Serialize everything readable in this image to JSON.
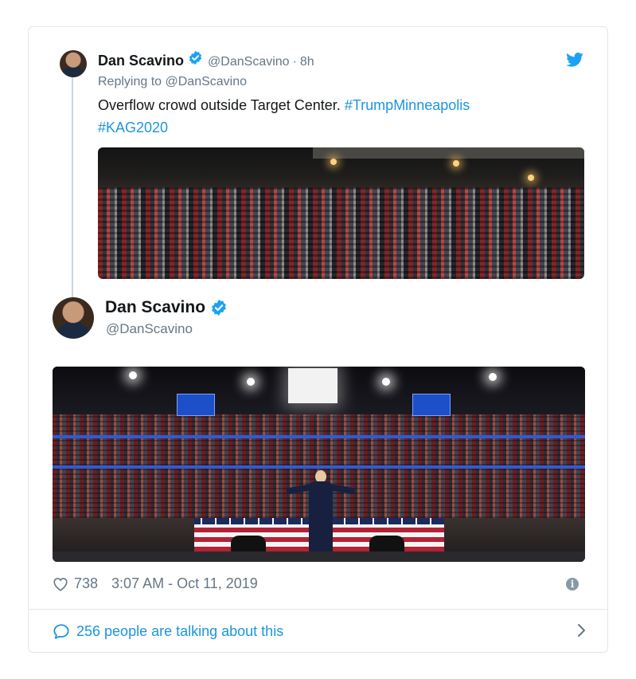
{
  "reply_tweet": {
    "name": "Dan Scavino",
    "handle": "@DanScavino",
    "dot": "·",
    "time": "8h",
    "replying_to_label": "Replying to",
    "replying_to_handle": "@DanScavino",
    "text": "Overflow crowd outside Target Center.",
    "hashtags": [
      "#TrumpMinneapolis",
      "#KAG2020"
    ],
    "icons": {
      "verified": "verified-badge-icon",
      "brand": "twitter-bird-icon"
    }
  },
  "main_tweet": {
    "name": "Dan Scavino",
    "handle": "@DanScavino",
    "likes": "738",
    "timestamp": "3:07 AM - Oct 11, 2019",
    "icons": {
      "like": "heart-icon",
      "info": "info-icon"
    }
  },
  "footer": {
    "talking_text": "256 people are talking about this",
    "icons": {
      "bubble": "speech-bubble-icon",
      "chevron": "chevron-right-icon"
    }
  },
  "colors": {
    "link": "#1b95e0",
    "secondary_text": "#657786",
    "primary_text": "#14171a",
    "border": "#e1e8ed",
    "verified": "#1da1f2"
  }
}
